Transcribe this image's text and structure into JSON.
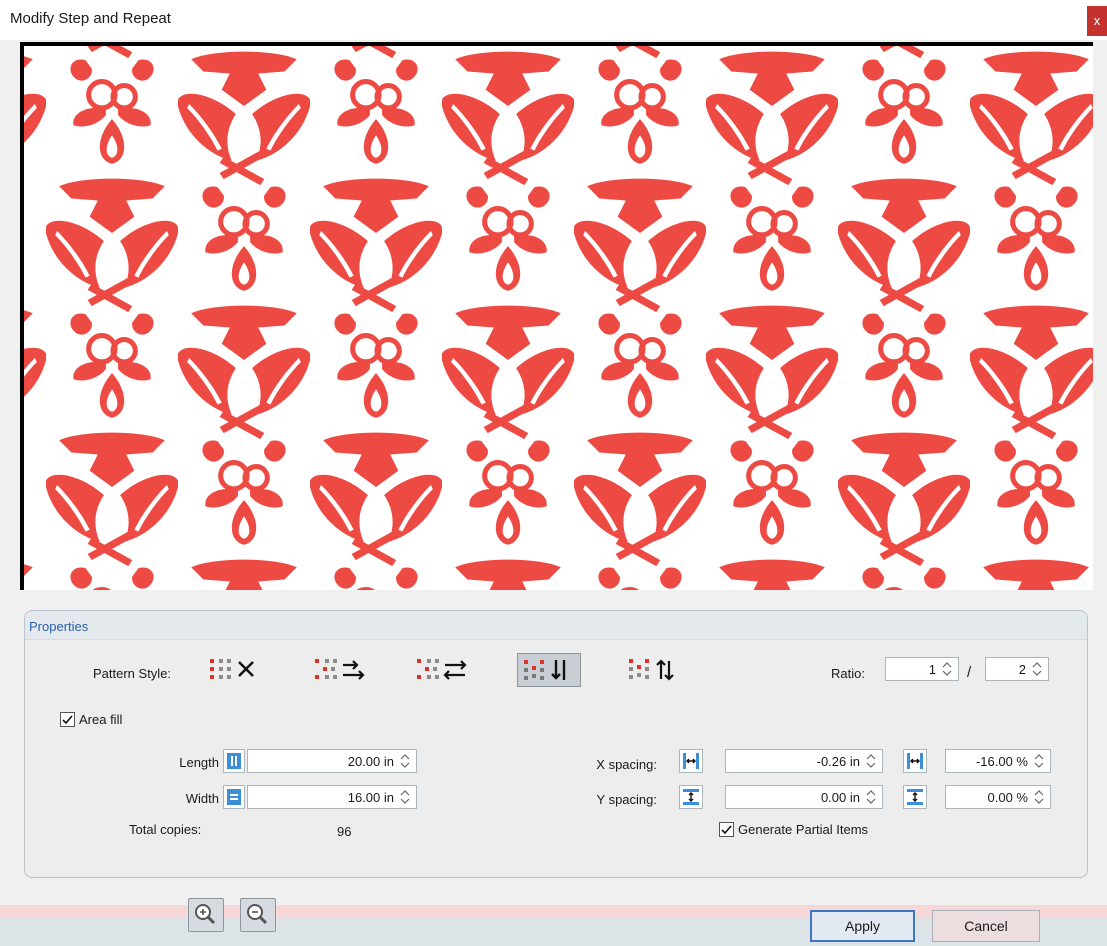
{
  "window": {
    "title": "Modify Step and Repeat",
    "close_label": "x"
  },
  "colors": {
    "pattern": "#ee4a44",
    "accent": "#2a5fa8",
    "close": "#c4322d",
    "apply_border": "#3b76c3"
  },
  "preview": {
    "icon": "damask-flower-pattern"
  },
  "properties": {
    "title": "Properties",
    "pattern_style_label": "Pattern Style:",
    "pattern_styles": [
      {
        "name": "grid-style-icon",
        "selected": false
      },
      {
        "name": "brick-horizontal-style-icon",
        "selected": false
      },
      {
        "name": "brick-horizontal-alternate-style-icon",
        "selected": false
      },
      {
        "name": "brick-vertical-style-icon",
        "selected": true
      },
      {
        "name": "brick-vertical-alternate-style-icon",
        "selected": false
      }
    ],
    "ratio_label": "Ratio:",
    "ratio_a": "1",
    "ratio_sep": "/",
    "ratio_b": "2",
    "area_fill_label": "Area fill",
    "area_fill_checked": true,
    "length_label": "Length",
    "length_value": "20.00 in",
    "width_label": "Width",
    "width_value": "16.00 in",
    "total_copies_label": "Total copies:",
    "total_copies_value": "96",
    "x_spacing_label": "X spacing:",
    "x_spacing_value": "-0.26 in",
    "x_spacing_percent": "-16.00 %",
    "y_spacing_label": "Y spacing:",
    "y_spacing_value": "0.00 in",
    "y_spacing_percent": "0.00 %",
    "generate_partial_label": "Generate Partial Items",
    "generate_partial_checked": true
  },
  "footer": {
    "zoom_in_icon": "zoom-in-icon",
    "zoom_out_icon": "zoom-out-icon",
    "apply_label": "Apply",
    "cancel_label": "Cancel"
  }
}
